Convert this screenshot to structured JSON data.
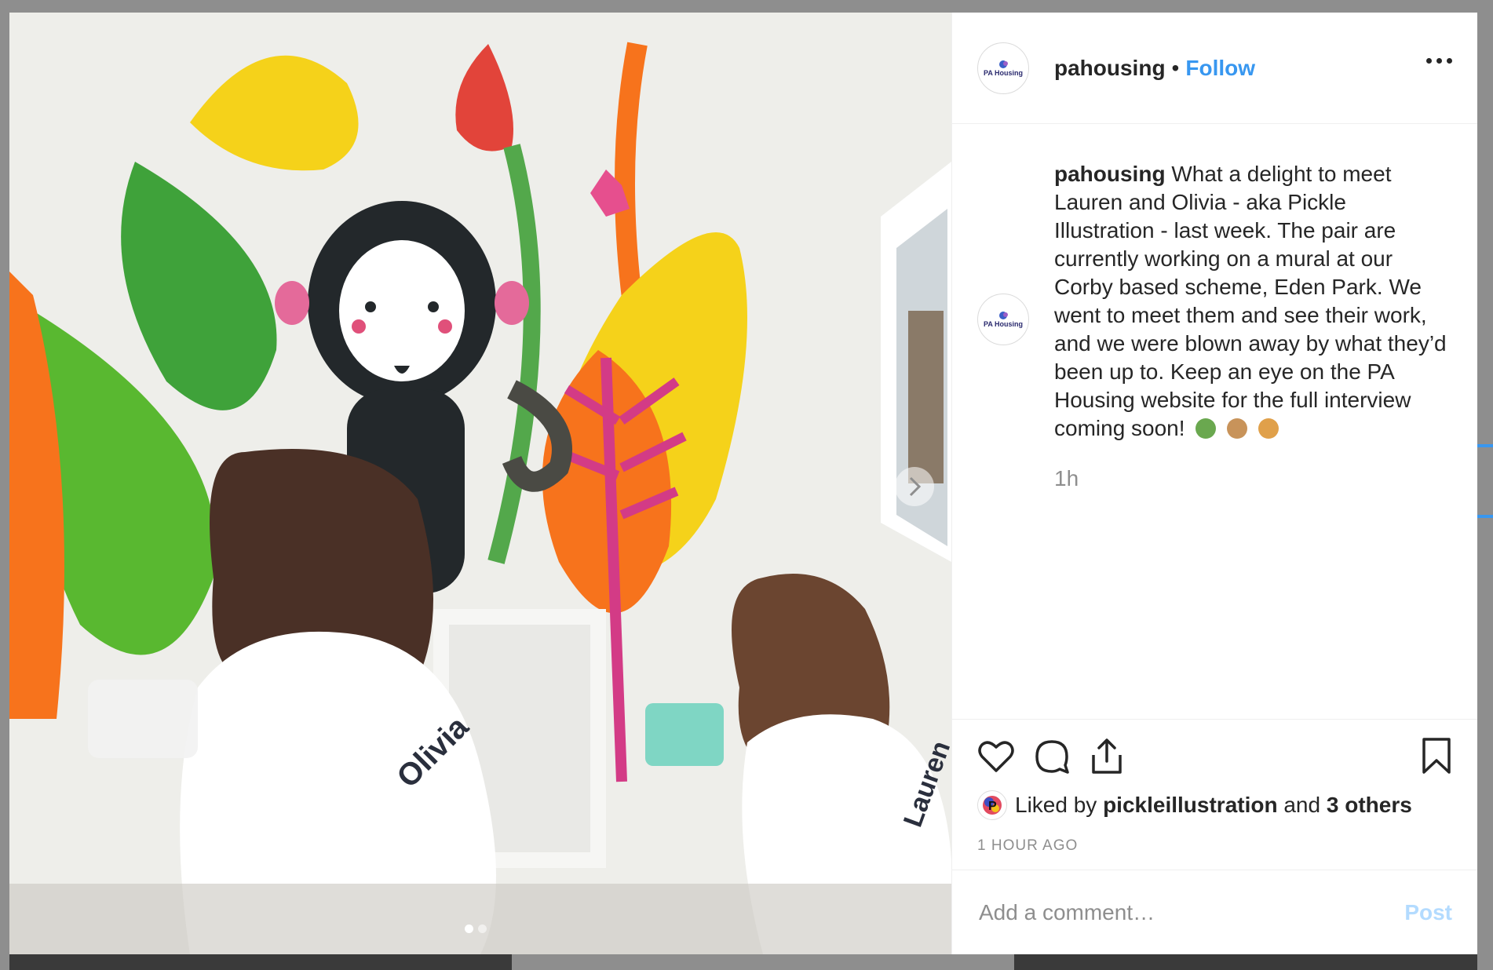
{
  "post": {
    "username": "pahousing",
    "separator": "•",
    "follow_label": "Follow",
    "avatar_text": "PA Housing",
    "caption": "What a delight to meet Lauren and Olivia - aka Pickle Illustration - last week. The pair are currently working on a mural at our Corby based scheme, Eden Park. We went to meet them and see their work, and we were blown away by what they’d been up to. Keep an eye on the PA Housing website for the full interview coming soon!",
    "caption_emojis": [
      "herb-emoji",
      "monkey-emoji",
      "palette-emoji"
    ],
    "caption_time": "1h",
    "likes_prefix": "Liked by",
    "liked_by_user": "pickleillustration",
    "likes_and": "and",
    "likes_others": "3 others",
    "timestamp": "1 HOUR AGO",
    "comment_placeholder": "Add a comment…",
    "post_label": "Post",
    "carousel": {
      "current": 1,
      "total": 2
    },
    "shirt_names": [
      "Olivia",
      "Lauren"
    ]
  },
  "colors": {
    "link_blue": "#3897f0",
    "post_disabled": "#b3dbff",
    "text": "#262626",
    "muted": "#8e8e8e"
  }
}
